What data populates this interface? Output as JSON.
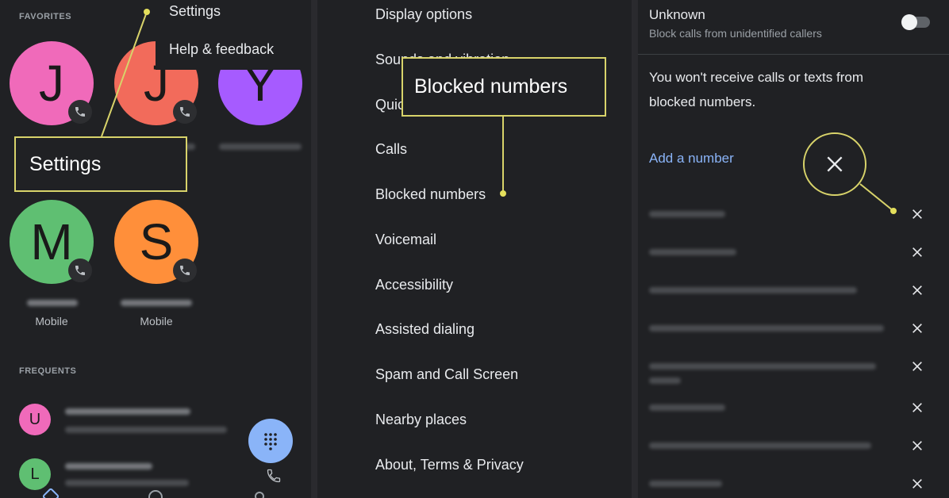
{
  "favorites": {
    "section_label": "FAVORITES",
    "contacts": [
      {
        "initial": "J",
        "color": "#f06aba",
        "type": ""
      },
      {
        "initial": "J",
        "color": "#f26b5b",
        "type": ""
      },
      {
        "initial": "Y",
        "color": "#a65bff",
        "type": ""
      },
      {
        "initial": "M",
        "color": "#5fbf72",
        "type": "Mobile"
      },
      {
        "initial": "S",
        "color": "#ff8f3a",
        "type": "Mobile"
      }
    ]
  },
  "overflow_menu": {
    "items": [
      "Settings",
      "Help & feedback"
    ]
  },
  "callout_settings": "Settings",
  "frequents": {
    "section_label": "FREQUENTS",
    "contacts": [
      {
        "initial": "U",
        "color": "#f06aba"
      },
      {
        "initial": "L",
        "color": "#5fbf72"
      }
    ]
  },
  "settings_menu": {
    "items": [
      "Display options",
      "Sounds and vibration",
      "Quick responses",
      "Calls",
      "Blocked numbers",
      "Voicemail",
      "Accessibility",
      "Assisted dialing",
      "Spam and Call Screen",
      "Nearby places",
      "About, Terms & Privacy"
    ]
  },
  "callout_blocked": "Blocked numbers",
  "blocked_page": {
    "unknown_title": "Unknown",
    "unknown_subtitle": "Block calls from unidentified callers",
    "unknown_enabled": false,
    "info_text_line1": "You won't receive calls or texts from",
    "info_text_line2": "blocked numbers.",
    "add_number_label": "Add a number",
    "blocked_entry_count": 8
  },
  "colors": {
    "accent_link": "#8ab4f8",
    "highlight": "#d8d36a",
    "background": "#202124"
  }
}
